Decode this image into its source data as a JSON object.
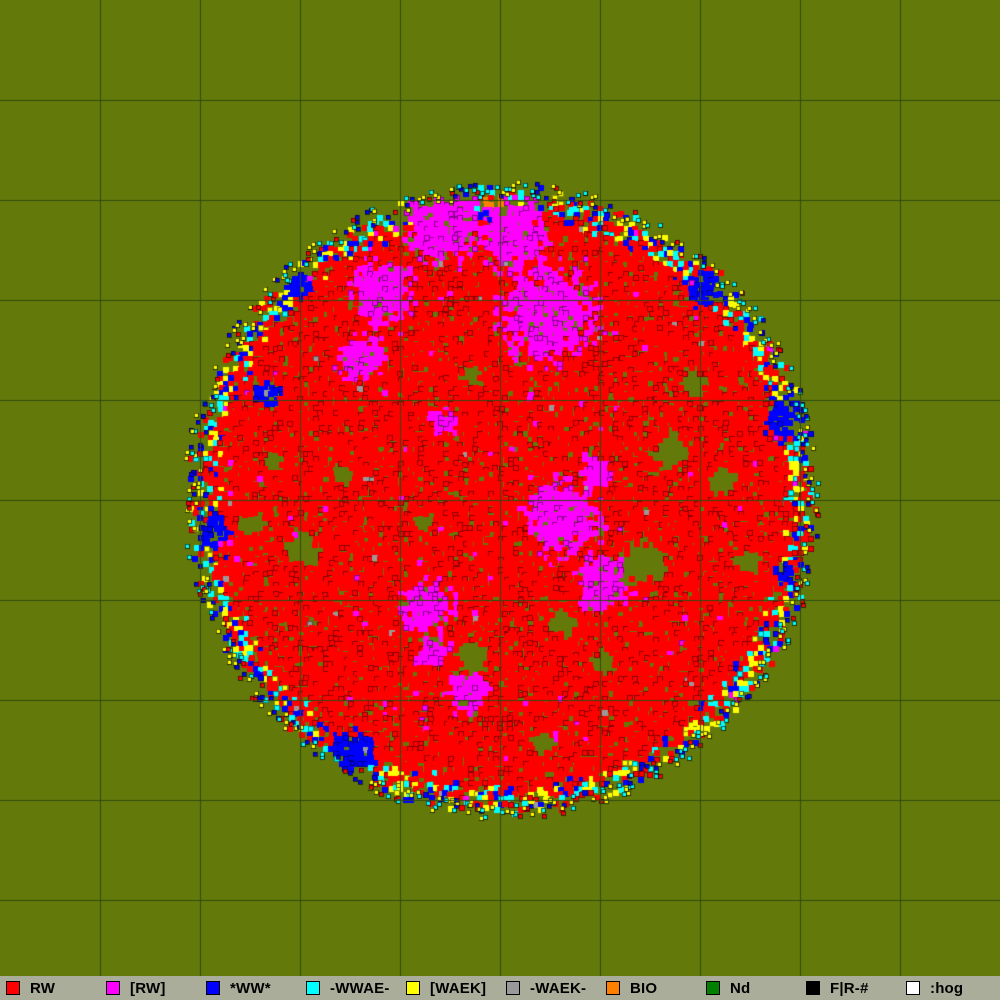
{
  "map": {
    "background_color": "#637a0a",
    "grid_color": "#2f4a10",
    "grid_cell_count": 10,
    "edge_color": "#000000",
    "disc": {
      "gap_color": "#637a0a",
      "dominant_class": "RW"
    }
  },
  "legend": {
    "background_color": "#a9ad99",
    "items": [
      {
        "label": "RW",
        "color": "#ff0000",
        "name": "legend-item-rw"
      },
      {
        "label": "[RW]",
        "color": "#ff00ff",
        "name": "legend-item-rw-bracket"
      },
      {
        "label": "*WW*",
        "color": "#0000ff",
        "name": "legend-item-ww"
      },
      {
        "label": "-WWAE-",
        "color": "#00ffff",
        "name": "legend-item-wwae"
      },
      {
        "label": "[WAEK]",
        "color": "#ffff00",
        "name": "legend-item-waek-bracket"
      },
      {
        "label": "-WAEK-",
        "color": "#999999",
        "name": "legend-item-waek"
      },
      {
        "label": "BIO",
        "color": "#ff7f00",
        "name": "legend-item-bio"
      },
      {
        "label": "Nd",
        "color": "#007f00",
        "name": "legend-item-nd"
      },
      {
        "label": "F|R-#",
        "color": "#000000",
        "name": "legend-item-fr"
      },
      {
        "label": ":hog",
        "color": "#ffffff",
        "name": "legend-item-hog"
      }
    ]
  }
}
